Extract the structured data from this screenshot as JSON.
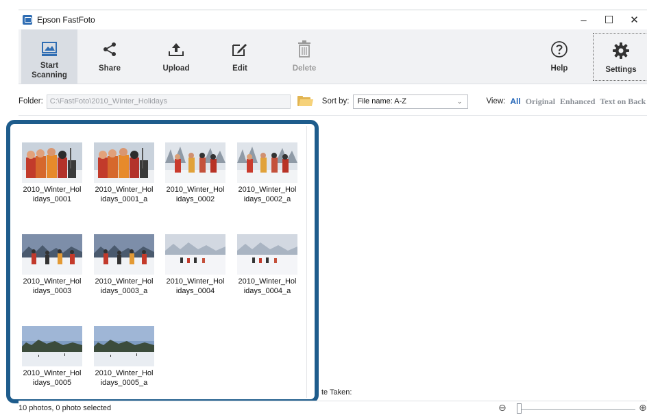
{
  "window": {
    "title": "Epson FastFoto",
    "minimize_glyph": "–",
    "maximize_glyph": "☐",
    "close_glyph": "✕"
  },
  "toolbar": {
    "start_scanning": "Start\nScanning",
    "share": "Share",
    "upload": "Upload",
    "edit": "Edit",
    "delete": "Delete",
    "help": "Help",
    "settings": "Settings"
  },
  "options": {
    "folder_label": "Folder:",
    "folder_value": "C:\\FastFoto\\2010_Winter_Holidays",
    "sort_label": "Sort by:",
    "sort_value": "File name: A-Z",
    "view_label": "View:",
    "view_all": "All",
    "view_original": "Original",
    "view_enhanced": "Enhanced",
    "view_text_on_back": "Text on Back"
  },
  "photos": [
    {
      "line1": "2010_Winter_Hol",
      "line2": "idays_0001",
      "scene": "group-closeup"
    },
    {
      "line1": "2010_Winter_Hol",
      "line2": "idays_0001_a",
      "scene": "group-closeup"
    },
    {
      "line1": "2010_Winter_Hol",
      "line2": "idays_0002",
      "scene": "group-trees"
    },
    {
      "line1": "2010_Winter_Hol",
      "line2": "idays_0002_a",
      "scene": "group-trees"
    },
    {
      "line1": "2010_Winter_Hol",
      "line2": "idays_0003",
      "scene": "skiers-near"
    },
    {
      "line1": "2010_Winter_Hol",
      "line2": "idays_0003_a",
      "scene": "skiers-near"
    },
    {
      "line1": "2010_Winter_Hol",
      "line2": "idays_0004",
      "scene": "skiers-far"
    },
    {
      "line1": "2010_Winter_Hol",
      "line2": "idays_0004_a",
      "scene": "skiers-far"
    },
    {
      "line1": "2010_Winter_Hol",
      "line2": "idays_0005",
      "scene": "landscape"
    },
    {
      "line1": "2010_Winter_Hol",
      "line2": "idays_0005_a",
      "scene": "landscape"
    }
  ],
  "details": {
    "date_taken_label": "te Taken:"
  },
  "status": {
    "text": "10 photos, 0 photo selected"
  },
  "colors": {
    "accent": "#2466b8",
    "highlight_border": "#1e5c8c",
    "toolbar_bg": "#f1f2f4"
  }
}
